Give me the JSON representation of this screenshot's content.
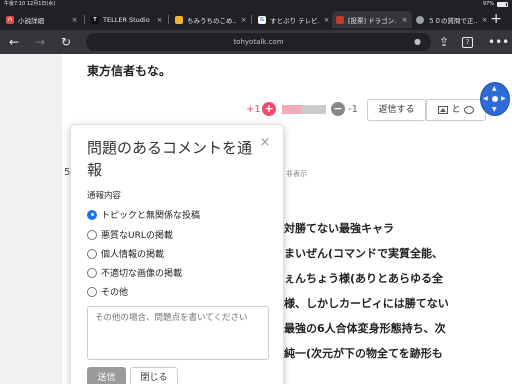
{
  "status_bar": {
    "time": "午後7:10",
    "date": "12月1日(水)",
    "battery": "97%"
  },
  "tabs": [
    {
      "title": "小説詳細",
      "favicon": "ハ",
      "favicon_color": "#e04b4b",
      "active": false
    },
    {
      "title": "TELLER Studio",
      "favicon": "T",
      "favicon_color": "#111111",
      "active": false
    },
    {
      "title": "ちみうちのこめ…",
      "favicon": "",
      "favicon_color": "#f2b632",
      "active": false
    },
    {
      "title": "すとぷり テレビ…",
      "favicon": "G",
      "favicon_color": "#ffffff",
      "active": false
    },
    {
      "title": "[投票] ドラゴン…",
      "favicon": "",
      "favicon_color": "#c0392b",
      "active": true
    },
    {
      "title": "５０の質問で正…",
      "favicon": "",
      "favicon_color": "#9aa0a6",
      "active": false
    }
  ],
  "toolbar": {
    "url": "tohyotalk.com",
    "tab_count": "7"
  },
  "page": {
    "line_top": "東方信者もな。",
    "vote_plus": "+1",
    "vote_minus": "-1",
    "vote_ratio": 0.45,
    "reply_label": "返信する",
    "media_label": "と",
    "comment_number": "5",
    "hide_label": "非表示",
    "body_lines": [
      "対勝てない最強キャラ",
      "まいぜん(コマンドで実質全能、",
      "ぇんちょう様(ありとあらゆる全",
      "様、しかしカービィには勝てない",
      "最強の6人合体変身形態持ち、次",
      "純一(次元が下の物全てを跡形も"
    ]
  },
  "modal": {
    "title": "問題のあるコメントを通報",
    "section_label": "通報内容",
    "options": [
      "トピックと無関係な投稿",
      "悪質なURLの掲載",
      "個人情報の掲載",
      "不適切な画像の掲載",
      "その他"
    ],
    "selected_index": 0,
    "textarea_placeholder": "その他の場合、問題点を書いてください",
    "submit_label": "送信",
    "close_label": "閉じる"
  }
}
